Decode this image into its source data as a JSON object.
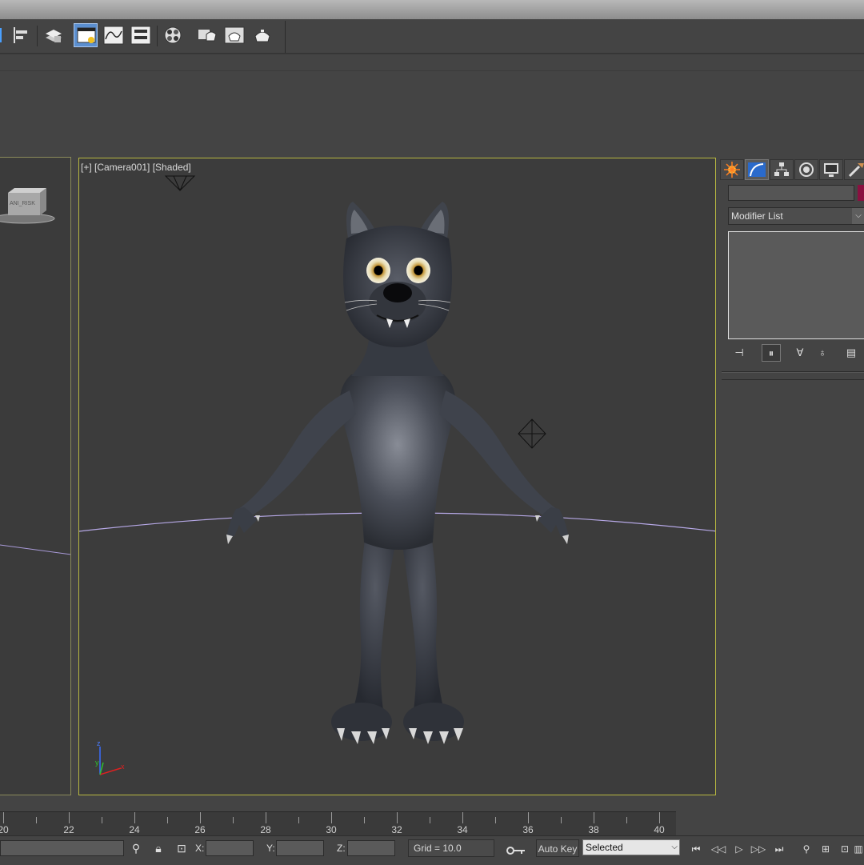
{
  "toolbar": {
    "buttons": [
      {
        "name": "layer-icon"
      },
      {
        "name": "align-icon"
      },
      {
        "name": "layer-manager-icon"
      },
      {
        "name": "scene-explorer-icon"
      },
      {
        "name": "curve-editor-icon"
      },
      {
        "name": "schematic-view-icon"
      },
      {
        "name": "material-editor-icon"
      },
      {
        "name": "render-setup-icon"
      },
      {
        "name": "rendered-frame-window-icon"
      },
      {
        "name": "render-production-icon"
      }
    ]
  },
  "viewport_left": {
    "label_text": "ANI_RISK"
  },
  "viewport_main": {
    "label": "[+] [Camera001] [Shaded]",
    "axis_labels": {
      "z": "z",
      "y": "y",
      "x": "x"
    }
  },
  "command_panel": {
    "tabs": [
      "create-tab",
      "modify-tab",
      "hierarchy-tab",
      "motion-tab",
      "display-tab",
      "utilities-tab"
    ],
    "active_tab": "modify-tab",
    "name_value": "",
    "object_color": "#8a1040",
    "modifier_list_label": "Modifier List",
    "stack_buttons": [
      "pin-stack-icon",
      "show-end-result-icon",
      "make-unique-icon",
      "remove-modifier-icon",
      "configure-modifier-sets-icon"
    ]
  },
  "timeline": {
    "ticks": [
      "20",
      "22",
      "24",
      "26",
      "28",
      "30",
      "32",
      "34",
      "36",
      "38",
      "40"
    ]
  },
  "status_bar": {
    "x_label": "X:",
    "y_label": "Y:",
    "z_label": "Z:",
    "x_value": "",
    "y_value": "",
    "z_value": "",
    "grid_text": "Grid = 10.0",
    "auto_key_label": "Auto Key",
    "key_filter_selected": "Selected"
  },
  "playback": {
    "buttons": [
      "go-to-start-icon",
      "previous-frame-icon",
      "play-icon",
      "next-frame-icon",
      "go-to-end-icon"
    ]
  },
  "colors": {
    "active_viewport_border": "#b7b740",
    "selection_highlight": "#5b8fd0",
    "object_color": "#8a1040"
  }
}
